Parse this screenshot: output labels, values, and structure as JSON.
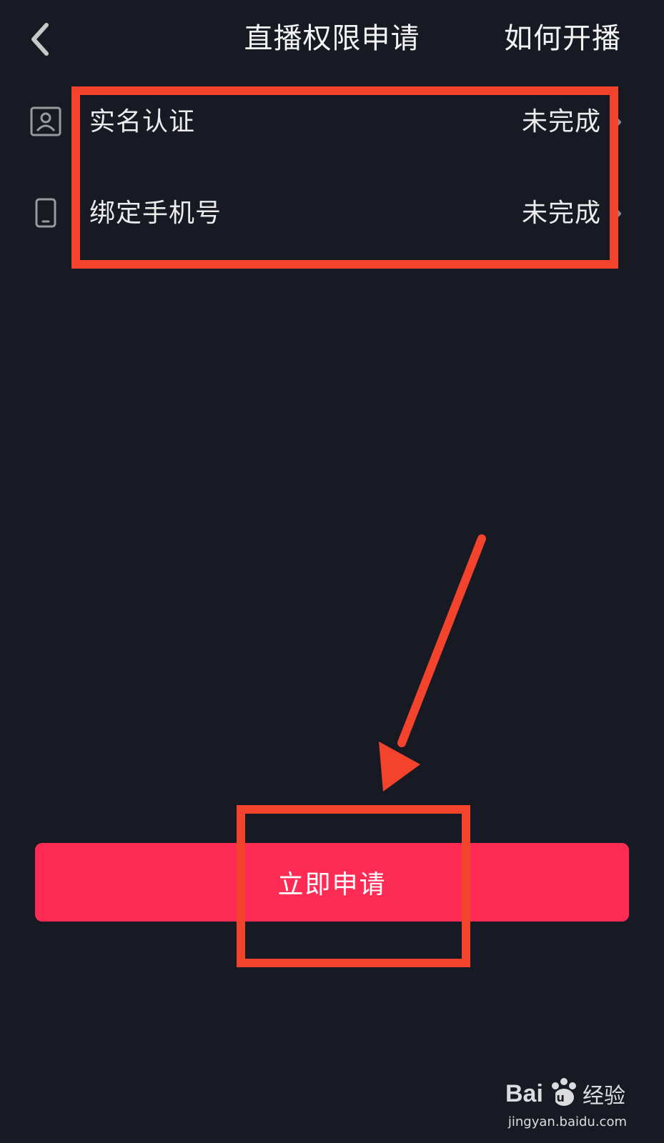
{
  "header": {
    "title": "直播权限申请",
    "help_label": "如何开播"
  },
  "requirements": [
    {
      "label": "实名认证",
      "status": "未完成",
      "icon": "id-card-icon"
    },
    {
      "label": "绑定手机号",
      "status": "未完成",
      "icon": "phone-icon"
    }
  ],
  "apply_button": {
    "label": "立即申请"
  },
  "colors": {
    "background": "#171923",
    "primary": "#fe2c55",
    "annotation": "#f4432c"
  },
  "watermark": {
    "brand": "Bai经验",
    "url": "jingyan.baidu.com"
  }
}
